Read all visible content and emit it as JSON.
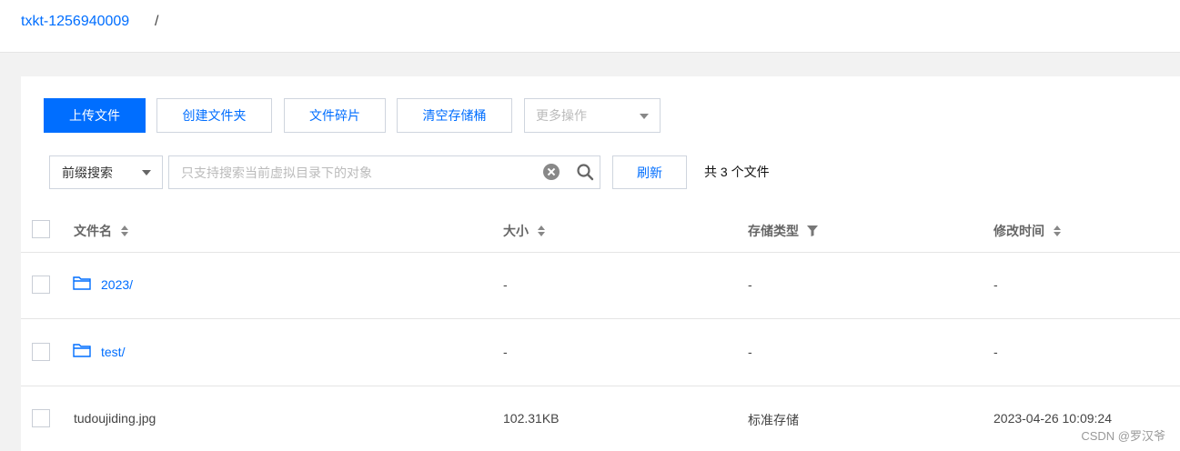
{
  "breadcrumb": {
    "bucket": "txkt-1256940009",
    "separator": "/"
  },
  "toolbar": {
    "upload": "上传文件",
    "create_folder": "创建文件夹",
    "fragments": "文件碎片",
    "clear_bucket": "清空存储桶",
    "more_actions": "更多操作"
  },
  "search": {
    "mode": "前缀搜索",
    "placeholder": "只支持搜索当前虚拟目录下的对象",
    "value": "",
    "refresh": "刷新",
    "count": "共 3 个文件"
  },
  "table": {
    "columns": [
      "文件名",
      "大小",
      "存储类型",
      "修改时间"
    ],
    "rows": [
      {
        "name": "2023/",
        "is_folder": true,
        "size": "-",
        "storage": "-",
        "modified": "-"
      },
      {
        "name": "test/",
        "is_folder": true,
        "size": "-",
        "storage": "-",
        "modified": "-"
      },
      {
        "name": "tudoujiding.jpg",
        "is_folder": false,
        "size": "102.31KB",
        "storage": "标准存储",
        "modified": "2023-04-26 10:09:24"
      }
    ]
  },
  "watermark": "CSDN @罗汉爷",
  "colors": {
    "accent": "#006eff",
    "border": "#cfd5de",
    "background": "#f2f2f2"
  },
  "icons": [
    "clear-icon",
    "search-icon",
    "sort-icon",
    "filter-icon",
    "folder-icon",
    "chevron-down-icon"
  ]
}
